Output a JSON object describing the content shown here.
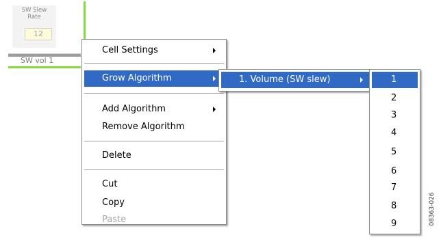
{
  "canvas": {
    "cell": {
      "title": "SW Slew\nRate",
      "value": "12"
    },
    "cell2": {
      "label": "SW vol 1"
    },
    "colors": {
      "wire": "#84dd3a",
      "value_bg": "#fdfbdb"
    }
  },
  "context_menu": {
    "items": [
      {
        "label": "Cell Settings",
        "has_submenu": true
      },
      {
        "label": "Grow Algorithm",
        "has_submenu": true,
        "highlighted": true
      },
      {
        "label": "Add Algorithm",
        "has_submenu": true
      },
      {
        "label": "Remove Algorithm"
      },
      {
        "label": "Delete"
      },
      {
        "label": "Cut"
      },
      {
        "label": "Copy"
      },
      {
        "label": "Paste",
        "disabled": true
      }
    ]
  },
  "grow_submenu": {
    "items": [
      {
        "label": "1. Volume (SW slew)",
        "has_submenu": true,
        "highlighted": true
      }
    ]
  },
  "count_submenu": {
    "items": [
      "1",
      "2",
      "3",
      "4",
      "5",
      "6",
      "7",
      "8",
      "9"
    ],
    "highlighted_index": 0
  },
  "figure_id": "08363-026",
  "colors": {
    "highlight": "#316ac5",
    "disabled_text": "#a8a8a8"
  }
}
